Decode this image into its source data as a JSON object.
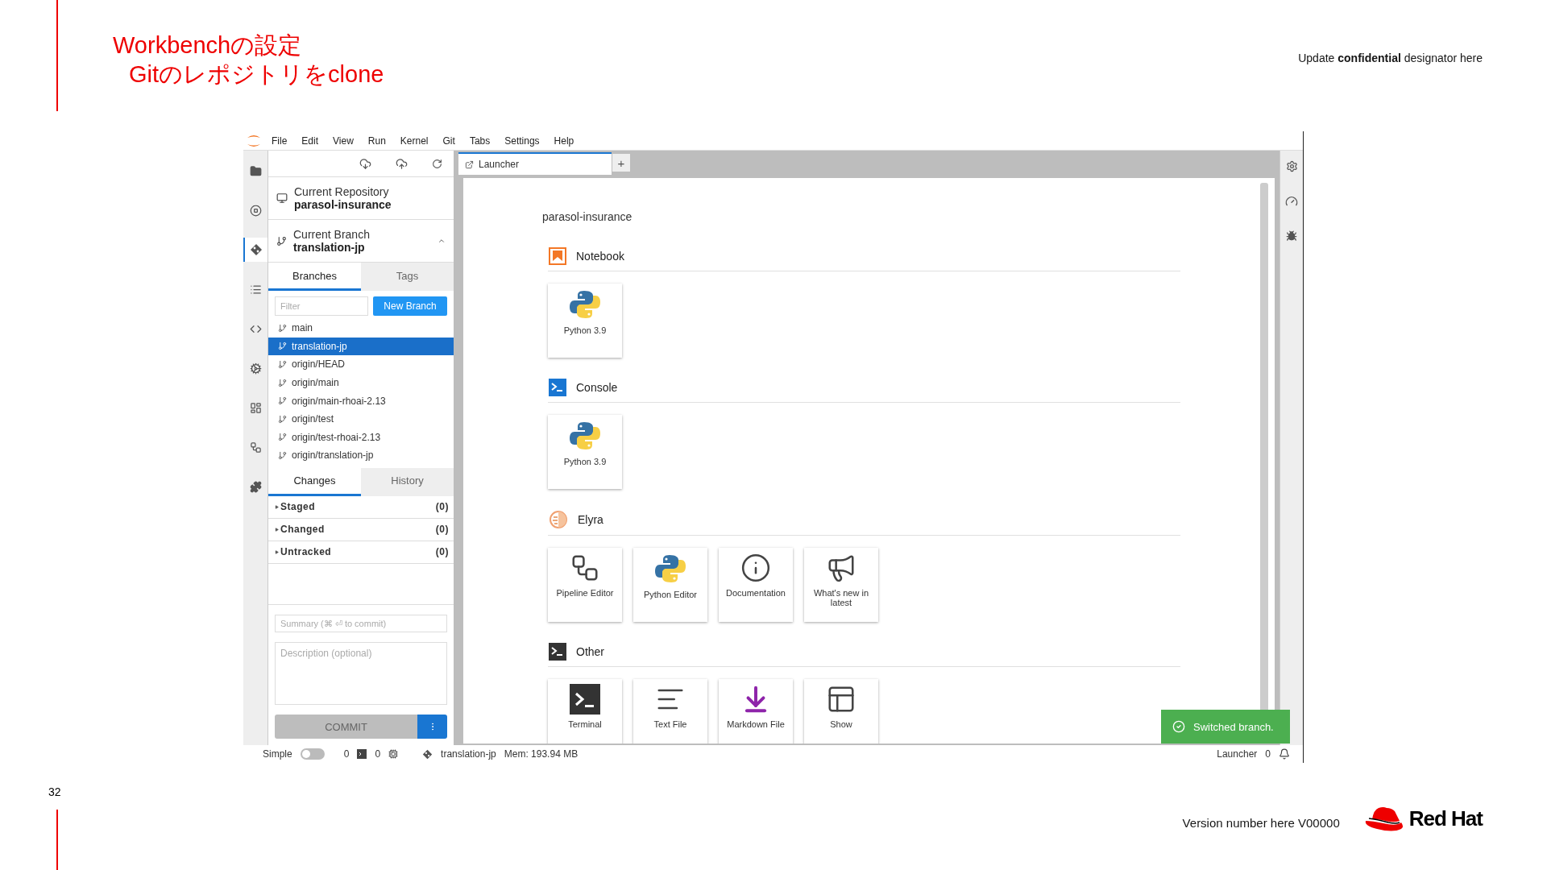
{
  "slide": {
    "title_lines": [
      "Workbenchの設定",
      "Gitのレポジトリをclone"
    ],
    "confidential": "Update **confidential** designator here",
    "page_number": "32",
    "version": "Version number here V00000",
    "logo_text": "Red Hat"
  },
  "menu": [
    "File",
    "Edit",
    "View",
    "Run",
    "Kernel",
    "Git",
    "Tabs",
    "Settings",
    "Help"
  ],
  "activity_bar": [
    {
      "kind": "folder",
      "selected": false
    },
    {
      "kind": "stop",
      "selected": false
    },
    {
      "kind": "git",
      "selected": true
    },
    {
      "kind": "list",
      "selected": false
    },
    {
      "kind": "code",
      "selected": false
    },
    {
      "kind": "gears",
      "selected": false
    },
    {
      "kind": "board",
      "selected": false
    },
    {
      "kind": "nodes",
      "selected": false
    },
    {
      "kind": "puzzle",
      "selected": false
    }
  ],
  "git_panel": {
    "repository": {
      "label": "Current Repository",
      "value": "parasol-insurance"
    },
    "branch": {
      "label": "Current Branch",
      "value": "translation-jp",
      "expanded": true
    },
    "branch_tabs": [
      {
        "label": "Branches",
        "selected": true
      },
      {
        "label": "Tags",
        "selected": false
      }
    ],
    "filter": {
      "placeholder": "Filter"
    },
    "new_branch": "New Branch",
    "branches": [
      {
        "name": "main",
        "selected": false
      },
      {
        "name": "translation-jp",
        "selected": true
      },
      {
        "name": "origin/HEAD",
        "selected": false
      },
      {
        "name": "origin/main",
        "selected": false
      },
      {
        "name": "origin/main-rhoai-2.13",
        "selected": false
      },
      {
        "name": "origin/test",
        "selected": false
      },
      {
        "name": "origin/test-rhoai-2.13",
        "selected": false
      },
      {
        "name": "origin/translation-jp",
        "selected": false
      }
    ],
    "change_tabs": [
      {
        "label": "Changes",
        "selected": true
      },
      {
        "label": "History",
        "selected": false
      }
    ],
    "change_groups": [
      {
        "label": "Staged",
        "count": "(0)"
      },
      {
        "label": "Changed",
        "count": "(0)"
      },
      {
        "label": "Untracked",
        "count": "(0)"
      }
    ],
    "summary": {
      "placeholder": "Summary (⌘ ⏎ to commit)"
    },
    "description": {
      "placeholder": "Description (optional)"
    },
    "commit": "COMMIT"
  },
  "tabs": [
    {
      "label": "Launcher",
      "selected": true
    }
  ],
  "new_tab": "+",
  "launcher": {
    "title": "parasol-insurance",
    "sections": [
      {
        "kind": "notebook",
        "title": "Notebook",
        "cards": [
          {
            "kind": "python",
            "label": "Python 3.9"
          }
        ]
      },
      {
        "kind": "console",
        "title": "Console",
        "cards": [
          {
            "kind": "python",
            "label": "Python 3.9"
          }
        ]
      },
      {
        "kind": "elyra",
        "title": "Elyra",
        "cards": [
          {
            "kind": "pipeline",
            "label": "Pipeline Editor"
          },
          {
            "kind": "python",
            "label": "Python Editor"
          },
          {
            "kind": "documentation",
            "label": "Documentation"
          },
          {
            "kind": "megaphone",
            "label": "What's new in latest"
          }
        ]
      },
      {
        "kind": "other",
        "title": "Other",
        "cards": [
          {
            "kind": "terminal",
            "label": "Terminal"
          },
          {
            "kind": "textfile",
            "label": "Text File"
          },
          {
            "kind": "markdown",
            "label": "Markdown File"
          },
          {
            "kind": "help",
            "label": "Show"
          }
        ]
      }
    ]
  },
  "toast": {
    "message": "Switched branch."
  },
  "status_bar": {
    "mode_label": "Simple",
    "simple_mode": false,
    "terminals": "0",
    "kernels": "0",
    "branch": "translation-jp",
    "memory": "Mem: 193.94 MB",
    "active_tab": "Launcher",
    "notifications": "0"
  }
}
